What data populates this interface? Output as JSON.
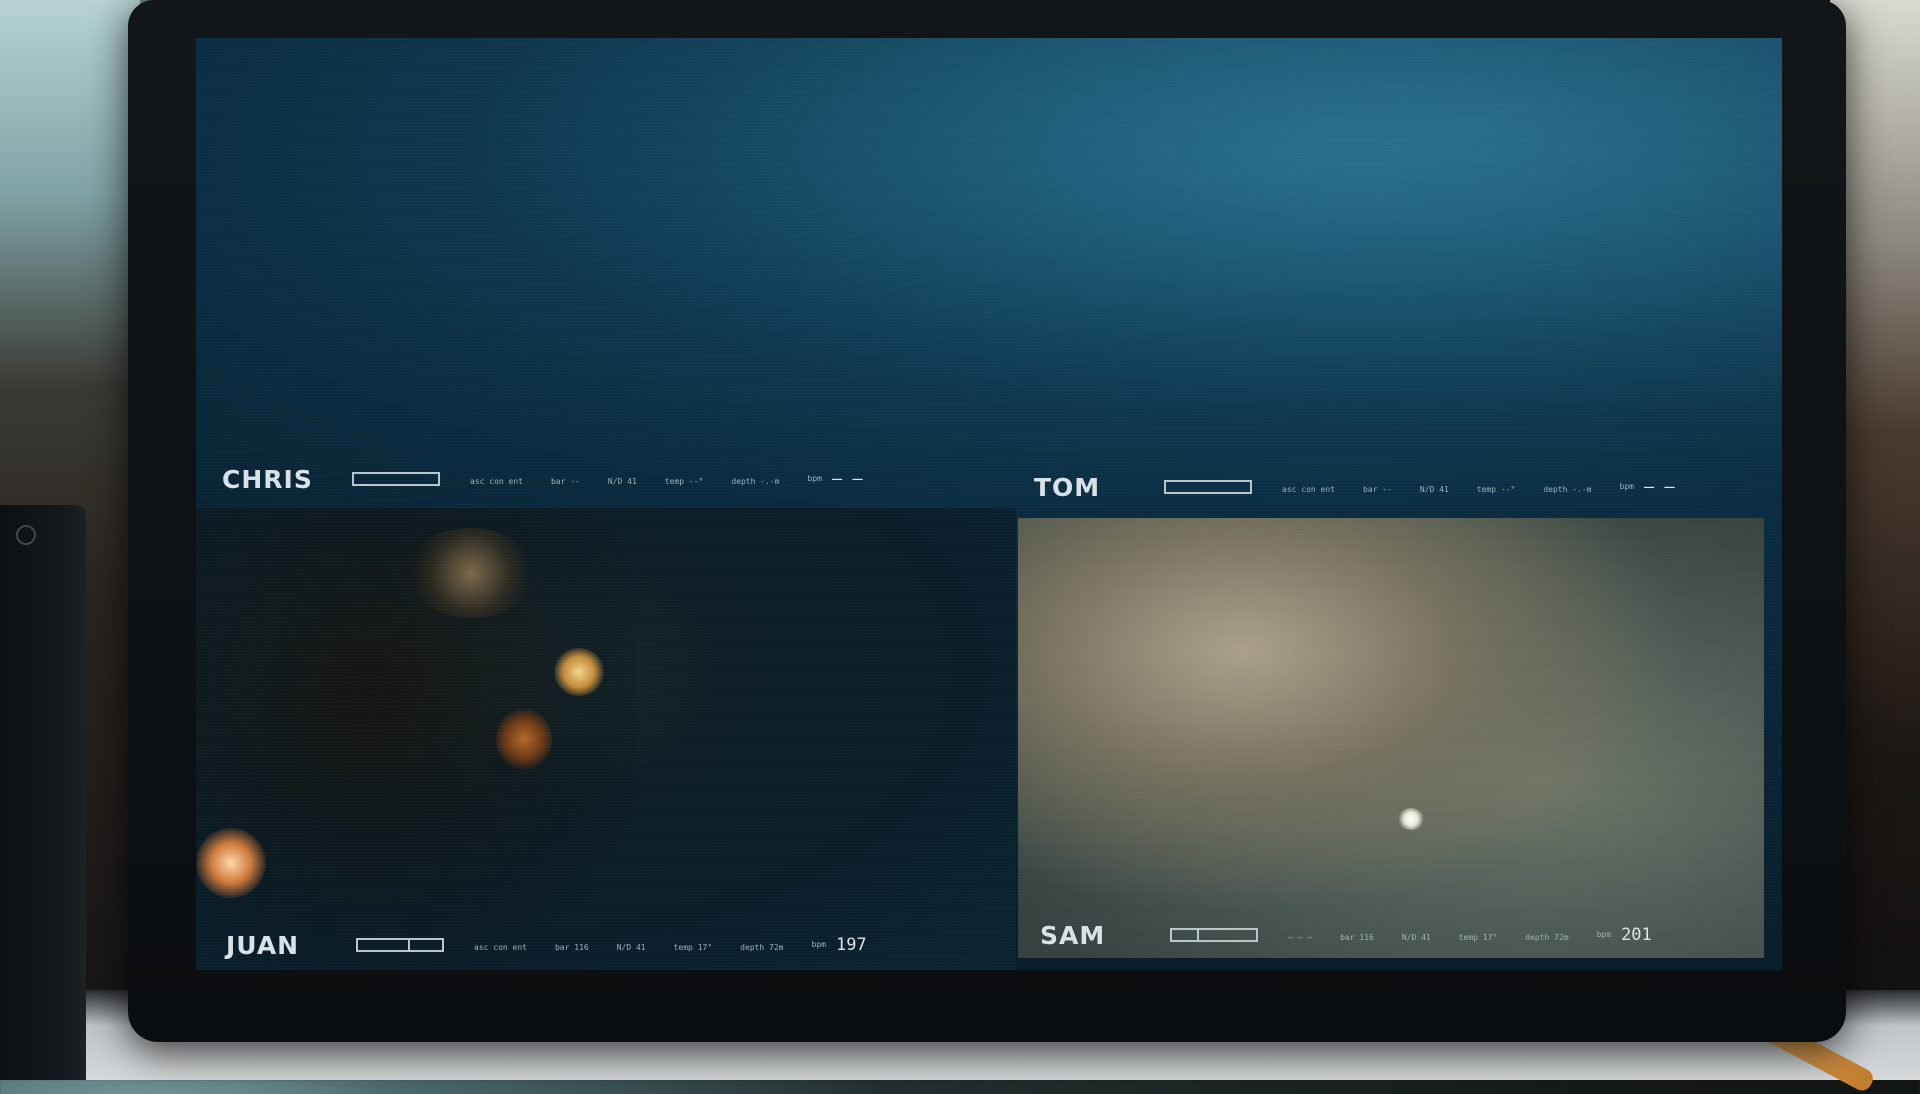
{
  "feeds": {
    "chris": {
      "name": "CHRIS",
      "status": "asc con ent",
      "bar": "bar --",
      "nd": "N/D 41",
      "temp": "temp --°",
      "depth": "depth -.-m",
      "bpm_label": "bpm",
      "bpm_value": "— —",
      "meter_fill": 0
    },
    "tom": {
      "name": "TOM",
      "status": "asc con ent",
      "bar": "bar --",
      "nd": "N/D 41",
      "temp": "temp --°",
      "depth": "depth -.-m",
      "bpm_label": "bpm",
      "bpm_value": "— —",
      "meter_fill": 0
    },
    "juan": {
      "name": "JUAN",
      "status": "asc con ent",
      "bar": "bar 116",
      "nd": "N/D 41",
      "temp": "temp 17°",
      "depth": "depth 72m",
      "bpm_label": "bpm",
      "bpm_value": "197",
      "meter_fill": 0.6
    },
    "sam": {
      "name": "SAM",
      "status": "— — —",
      "bar": "bar 116",
      "nd": "N/D 41",
      "temp": "temp 17°",
      "depth": "depth 72m",
      "bpm_label": "bpm",
      "bpm_value": "201",
      "meter_fill": 0.3
    }
  },
  "colors": {
    "hud_text": "#c9d6dc",
    "water_blue": "#0c3246"
  }
}
